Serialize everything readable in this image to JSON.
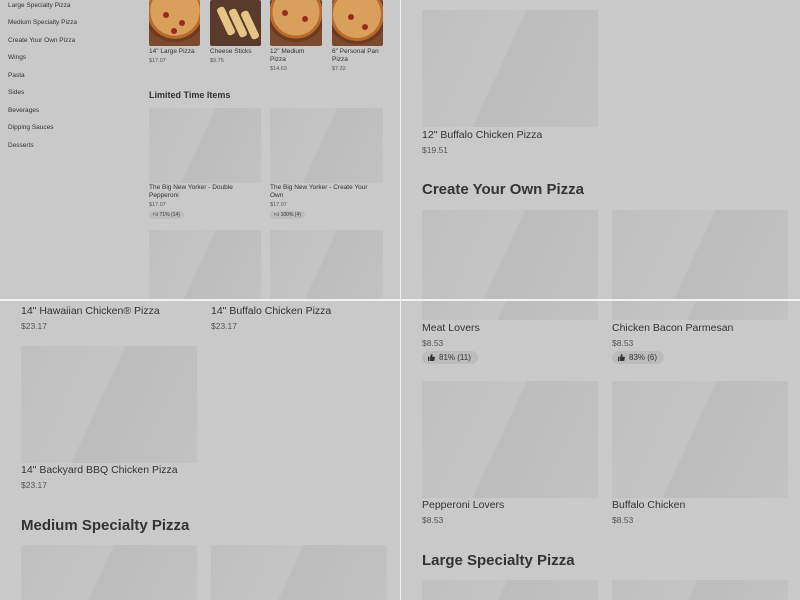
{
  "sidebar": {
    "items": [
      "Large Specialty Pizza",
      "Medium Specialty Pizza",
      "Create Your Own Pizza",
      "Wings",
      "Pasta",
      "Sides",
      "Beverages",
      "Dipping Sauces",
      "Desserts"
    ]
  },
  "top_items": [
    {
      "name": "14\" Large Pizza",
      "price": "$17.07"
    },
    {
      "name": "Cheese Sticks",
      "price": "$9.75"
    },
    {
      "name": "12\" Medium Pizza",
      "price": "$14.63"
    },
    {
      "name": "6\" Personal Pan Pizza",
      "price": "$7.32"
    }
  ],
  "limited": {
    "title": "Limited Time Items",
    "items": [
      {
        "name": "The Big New Yorker - Double Pepperoni",
        "price": "$17.07",
        "rating": "71% (14)"
      },
      {
        "name": "The Big New Yorker - Create Your Own",
        "price": "$17.07",
        "rating": "100% (4)"
      }
    ]
  },
  "q2": {
    "item": {
      "name": "12\" Buffalo Chicken Pizza",
      "price": "$19.51"
    },
    "section_title": "Create Your Own Pizza"
  },
  "q3": {
    "items": [
      {
        "name": "14\" Hawaiian Chicken® Pizza",
        "price": "$23.17"
      },
      {
        "name": "14\" Buffalo Chicken Pizza",
        "price": "$23.17"
      },
      {
        "name": "14\" Backyard BBQ Chicken Pizza",
        "price": "$23.17"
      }
    ],
    "section_title": "Medium Specialty Pizza"
  },
  "q4": {
    "items": [
      {
        "name": "Meat Lovers",
        "price": "$8.53",
        "rating": "81% (11)"
      },
      {
        "name": "Chicken Bacon Parmesan",
        "price": "$8.53",
        "rating": "83% (6)"
      },
      {
        "name": "Pepperoni Lovers",
        "price": "$8.53"
      },
      {
        "name": "Buffalo Chicken",
        "price": "$8.53"
      }
    ],
    "section_title": "Large Specialty Pizza"
  },
  "icons": {
    "rating": "thumbs-up-icon"
  }
}
